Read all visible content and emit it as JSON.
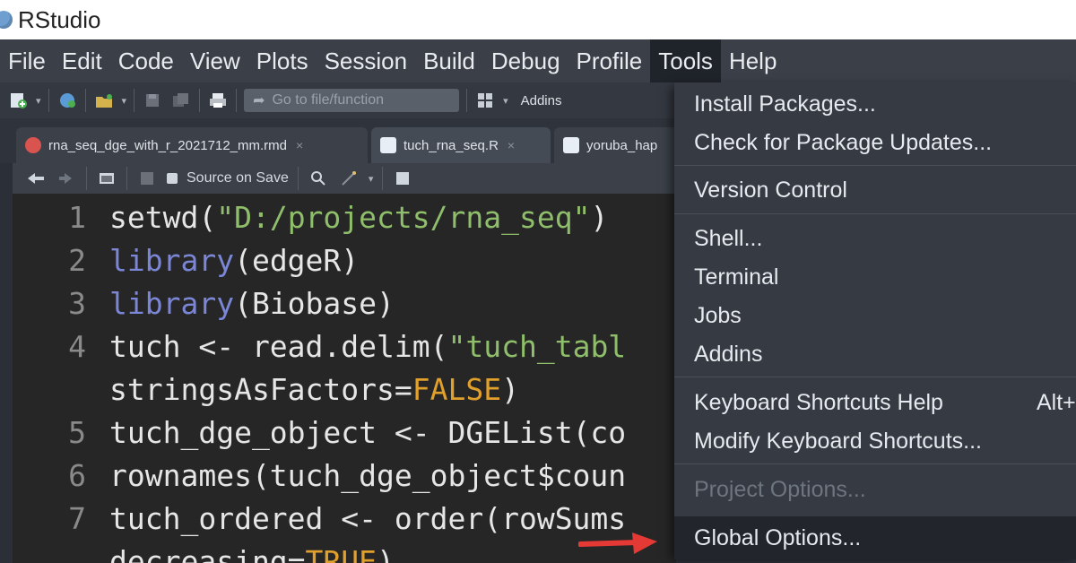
{
  "window": {
    "title": "RStudio"
  },
  "menu": [
    "File",
    "Edit",
    "Code",
    "View",
    "Plots",
    "Session",
    "Build",
    "Debug",
    "Profile",
    "Tools",
    "Help"
  ],
  "menu_active": "Tools",
  "toolbar": {
    "goto_placeholder": "Go to file/function",
    "addins_label": "Addins",
    "icons": [
      "new-file-icon",
      "open-project-icon",
      "open-file-icon",
      "save-icon",
      "save-all-icon",
      "print-icon",
      "grid-layout-icon"
    ]
  },
  "tabs": [
    {
      "name": "rna_seq_dge_with_r_2021712_mm.rmd",
      "type": "rmd",
      "active": false
    },
    {
      "name": "tuch_rna_seq.R",
      "type": "r",
      "active": true
    },
    {
      "name": "yoruba_hap",
      "type": "r",
      "active": false
    }
  ],
  "editor_toolbar": {
    "source_on_save": "Source on Save"
  },
  "code_lines": [
    {
      "number": "1",
      "tokens": [
        {
          "t": "setwd(",
          "c": "code"
        },
        {
          "t": "\"D:/projects/rna_seq\"",
          "c": "str"
        },
        {
          "t": ")",
          "c": "code"
        }
      ]
    },
    {
      "number": "2",
      "tokens": [
        {
          "t": "library",
          "c": "kw"
        },
        {
          "t": "(edgeR)",
          "c": "code"
        }
      ]
    },
    {
      "number": "3",
      "tokens": [
        {
          "t": "library",
          "c": "kw"
        },
        {
          "t": "(Biobase)",
          "c": "code"
        }
      ]
    },
    {
      "number": "4",
      "tokens": [
        {
          "t": "tuch <- read.delim(",
          "c": "code"
        },
        {
          "t": "\"tuch_tabl",
          "c": "str"
        }
      ]
    },
    {
      "number": "",
      "tokens": [
        {
          "t": "stringsAsFactors=",
          "c": "code"
        },
        {
          "t": "FALSE",
          "c": "bool"
        },
        {
          "t": ")",
          "c": "code"
        }
      ]
    },
    {
      "number": "5",
      "tokens": [
        {
          "t": "tuch_dge_object <- DGEList(co",
          "c": "code"
        }
      ]
    },
    {
      "number": "6",
      "tokens": [
        {
          "t": "rownames(tuch_dge_object$coun",
          "c": "code"
        }
      ]
    },
    {
      "number": "7",
      "tokens": [
        {
          "t": "tuch_ordered <- order(rowSums",
          "c": "code"
        }
      ]
    },
    {
      "number": "",
      "tokens": [
        {
          "t": "decreasing=",
          "c": "code"
        },
        {
          "t": "TRUE",
          "c": "bool"
        },
        {
          "t": ")",
          "c": "code"
        }
      ]
    }
  ],
  "tools_menu": [
    {
      "label": "Install Packages...",
      "disabled": false
    },
    {
      "label": "Check for Package Updates...",
      "disabled": false
    },
    {
      "label": "Version Control",
      "disabled": false
    },
    {
      "label": "Shell...",
      "disabled": false
    },
    {
      "label": "Terminal",
      "disabled": false
    },
    {
      "label": "Jobs",
      "disabled": false
    },
    {
      "label": "Addins",
      "disabled": false
    },
    {
      "label": "Keyboard Shortcuts Help",
      "disabled": false,
      "shortcut": "Alt+"
    },
    {
      "label": "Modify Keyboard Shortcuts...",
      "disabled": false
    },
    {
      "label": "Project Options...",
      "disabled": true
    },
    {
      "label": "Global Options...",
      "disabled": false,
      "highlighted": true
    }
  ],
  "colors": {
    "menu_bg": "#3a3f48",
    "editor_bg": "#262626",
    "keyword": "#7b86d6",
    "string": "#8fbf6a",
    "boolean": "#e0a02b",
    "arrow": "#e53935"
  }
}
